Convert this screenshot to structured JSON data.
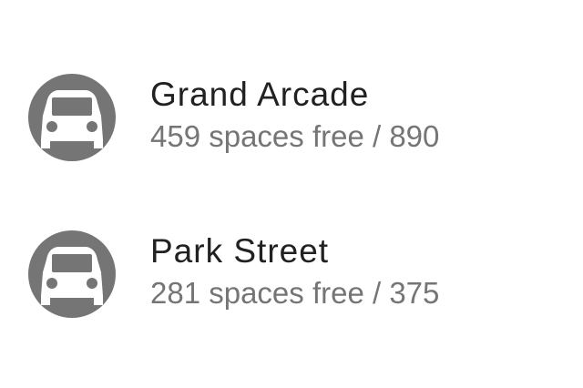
{
  "car_parks": [
    {
      "name": "Grand Arcade",
      "availability": "459 spaces free / 890",
      "icon": "car-icon"
    },
    {
      "name": "Park Street",
      "availability": "281 spaces free / 375",
      "icon": "car-icon"
    }
  ],
  "colors": {
    "icon_background": "#757575",
    "icon_foreground": "#ffffff",
    "primary_text": "#212121",
    "secondary_text": "#757575",
    "background": "#ffffff"
  }
}
